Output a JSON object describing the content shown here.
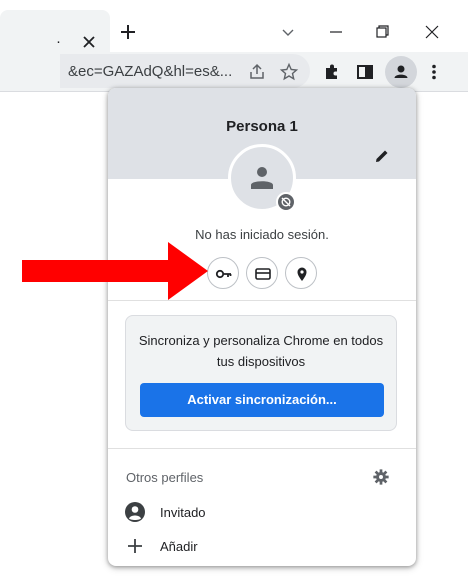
{
  "tab": {
    "title": "·",
    "close": "×",
    "new_tab": "+"
  },
  "toolbar": {
    "url": "&ec=GAZAdQ&hl=es&..."
  },
  "profile_menu": {
    "profile_name": "Persona 1",
    "status": "No has iniciado sesión.",
    "quick_actions": [
      "passwords-key",
      "payment-card",
      "addresses-pin"
    ],
    "sync_card": {
      "text": "Sincroniza y personaliza Chrome en todos tus dispositivos",
      "button_label": "Activar sincronización..."
    },
    "other_profiles": {
      "label": "Otros perfiles",
      "items": [
        {
          "label": "Invitado",
          "icon": "guest-avatar-icon"
        },
        {
          "label": "Añadir",
          "icon": "plus-icon"
        }
      ]
    }
  },
  "colors": {
    "accent": "#1a73e8",
    "header_bg": "#dee1e6",
    "arrow": "#ff0000"
  }
}
